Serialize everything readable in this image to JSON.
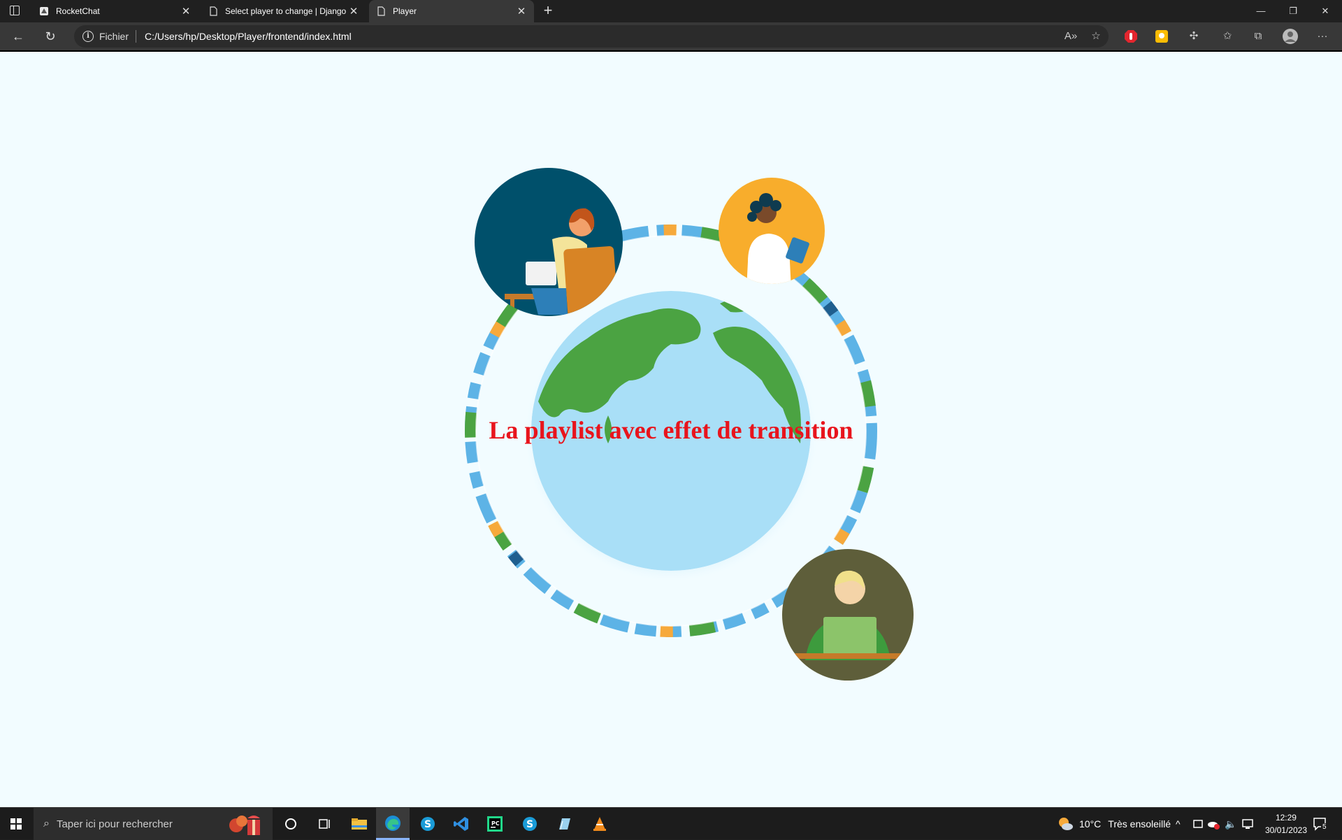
{
  "browser": {
    "tabs": [
      {
        "label": "RocketChat",
        "close": "✕"
      },
      {
        "label": "Select player to change | Django",
        "close": "✕"
      },
      {
        "label": "Player",
        "close": "✕"
      }
    ],
    "address": {
      "scheme": "Fichier",
      "url": "C:/Users/hp/Desktop/Player/frontend/index.html"
    }
  },
  "page": {
    "headline": "La playlist avec effet de transition"
  },
  "taskbar": {
    "search_placeholder": "Taper ici pour rechercher",
    "weather_temp": "10°C",
    "weather_text": "Très ensoleillé",
    "time": "12:29",
    "date": "30/01/2023",
    "notification_count": "5"
  },
  "colors": {
    "page_bg": "#f2fcff",
    "headline": "#e8141c",
    "globe_water": "#a9dff7",
    "globe_land": "#4ba342",
    "ring_blue": "#5db3e6",
    "ring_green": "#4ba342",
    "ring_orange": "#f6a93b",
    "ring_navy": "#1f5f8f"
  }
}
